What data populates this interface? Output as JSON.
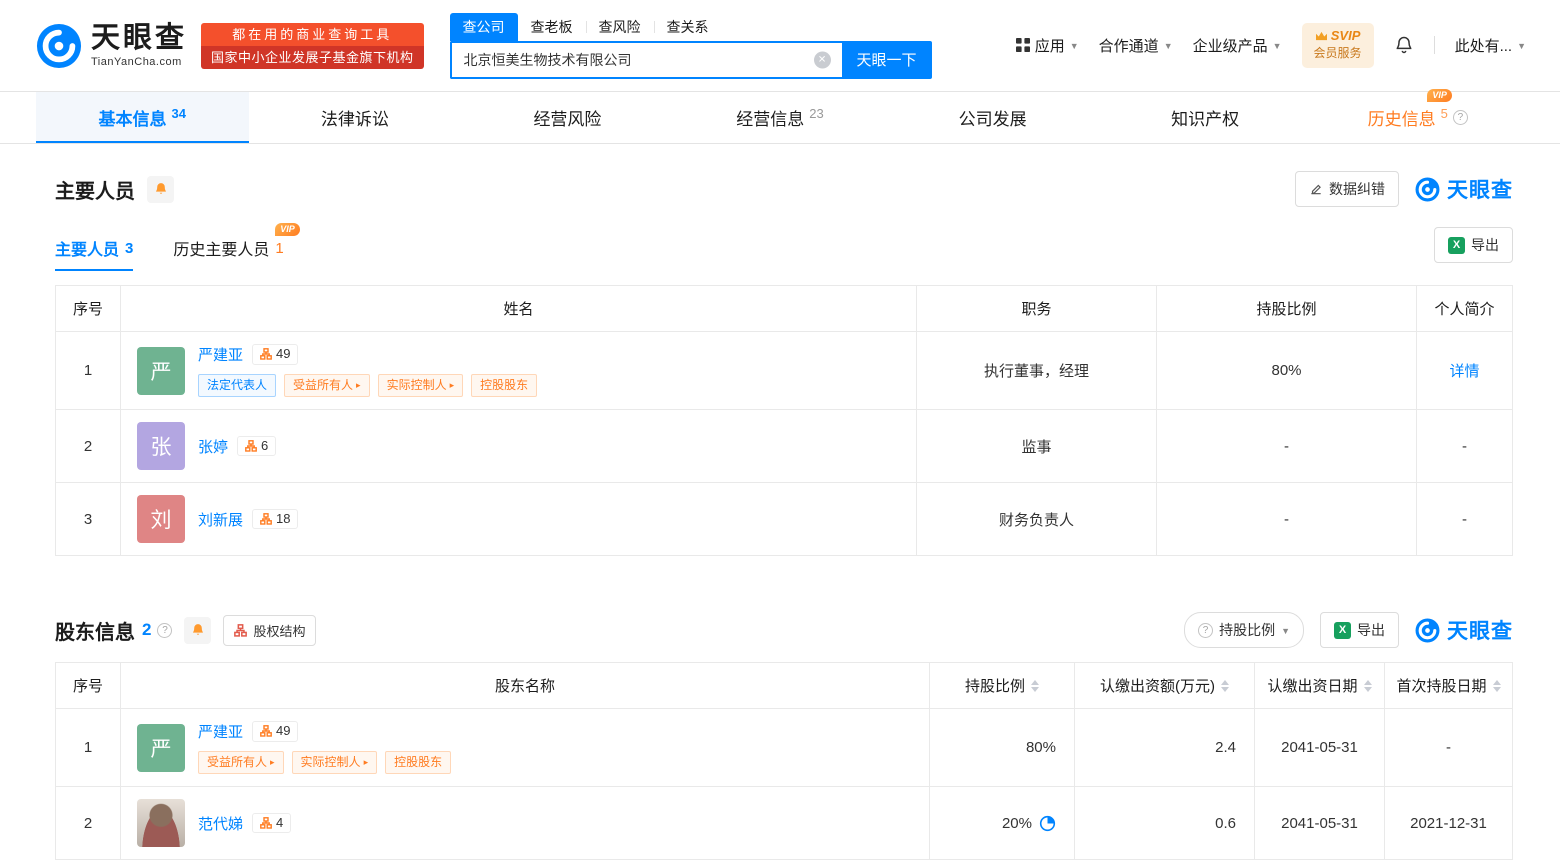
{
  "colors": {
    "accent_blue": "#0084ff",
    "accent_orange": "#ff7c21"
  },
  "header": {
    "logo_title": "天眼查",
    "logo_domain": "TianYanCha.com",
    "promo_line1": "都在用的商业查询工具",
    "promo_line2": "国家中小企业发展子基金旗下机构",
    "search_tabs": [
      {
        "label": "查公司"
      },
      {
        "label": "查老板"
      },
      {
        "label": "查风险"
      },
      {
        "label": "查关系"
      }
    ],
    "search_value": "北京恒美生物技术有限公司",
    "search_button": "天眼一下",
    "nav_apps": "应用",
    "nav_cooperation": "合作通道",
    "nav_enterprise": "企业级产品",
    "svip_line1": "SVIP",
    "svip_line2": "会员服务",
    "user_name": "此处有..."
  },
  "tabs": [
    {
      "label": "基本信息",
      "count": "34"
    },
    {
      "label": "法律诉讼",
      "count": ""
    },
    {
      "label": "经营风险",
      "count": ""
    },
    {
      "label": "经营信息",
      "count": "23"
    },
    {
      "label": "公司发展",
      "count": ""
    },
    {
      "label": "知识产权",
      "count": ""
    },
    {
      "label": "历史信息",
      "count": "5",
      "vip": "VIP"
    }
  ],
  "staff": {
    "title": "主要人员",
    "correction": "数据纠错",
    "brand": "天眼查",
    "tab_current": "主要人员",
    "tab_current_count": "3",
    "tab_history": "历史主要人员",
    "tab_history_count": "1",
    "vip": "VIP",
    "export": "导出",
    "headers": {
      "no": "序号",
      "name": "姓名",
      "position": "职务",
      "ratio": "持股比例",
      "profile": "个人简介"
    },
    "rows": [
      {
        "no": "1",
        "avatar": "严",
        "name": "严建亚",
        "badge": "49",
        "tag_legal": "法定代表人",
        "tag_benefit": "受益所有人",
        "tag_control": "实际控制人",
        "tag_holding": "控股股东",
        "position": "执行董事，经理",
        "ratio": "80%",
        "profile": "详情"
      },
      {
        "no": "2",
        "avatar": "张",
        "name": "张婷",
        "badge": "6",
        "position": "监事",
        "ratio": "-",
        "profile": "-"
      },
      {
        "no": "3",
        "avatar": "刘",
        "name": "刘新展",
        "badge": "18",
        "position": "财务负责人",
        "ratio": "-",
        "profile": "-"
      }
    ]
  },
  "shareholders": {
    "title": "股东信息",
    "count": "2",
    "structure_button": "股权结构",
    "filter_button": "持股比例",
    "export": "导出",
    "brand": "天眼查",
    "headers": {
      "no": "序号",
      "name": "股东名称",
      "ratio": "持股比例",
      "amount": "认缴出资额(万元)",
      "date": "认缴出资日期",
      "first_date": "首次持股日期"
    },
    "rows": [
      {
        "no": "1",
        "avatar": "严",
        "name": "严建亚",
        "badge": "49",
        "tag_benefit": "受益所有人",
        "tag_control": "实际控制人",
        "tag_holding": "控股股东",
        "ratio": "80%",
        "amount": "2.4",
        "date": "2041-05-31",
        "first_date": "-"
      },
      {
        "no": "2",
        "name": "范代娣",
        "badge": "4",
        "ratio": "20%",
        "amount": "0.6",
        "date": "2041-05-31",
        "first_date": "2021-12-31"
      }
    ]
  }
}
